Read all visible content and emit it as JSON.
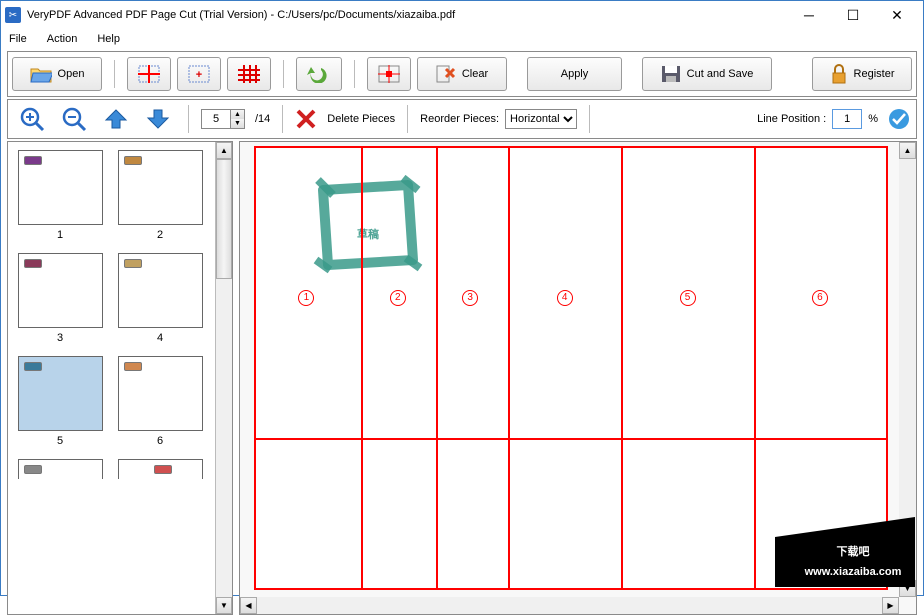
{
  "title": "VeryPDF Advanced PDF Page Cut (Trial Version) - C:/Users/pc/Documents/xiazaiba.pdf",
  "menu": {
    "file": "File",
    "action": "Action",
    "help": "Help"
  },
  "tb": {
    "open": "Open",
    "clear": "Clear",
    "apply": "Apply",
    "cutsave": "Cut and Save",
    "register": "Register"
  },
  "tb2": {
    "pagecur": "5",
    "pagetotal": "/14",
    "delpieces": "Delete Pieces",
    "reorder": "Reorder Pieces:",
    "reorderval": "Horizontal",
    "linepos": "Line Position :",
    "lineval": "1",
    "pct": "%"
  },
  "thumbs": [
    "1",
    "2",
    "3",
    "4",
    "5",
    "6"
  ],
  "pieces": [
    "1",
    "2",
    "3",
    "4",
    "5",
    "6"
  ],
  "stamp": "草稿",
  "logo": {
    "top": "下载吧",
    "bottom": "www.xiazaiba.com"
  }
}
